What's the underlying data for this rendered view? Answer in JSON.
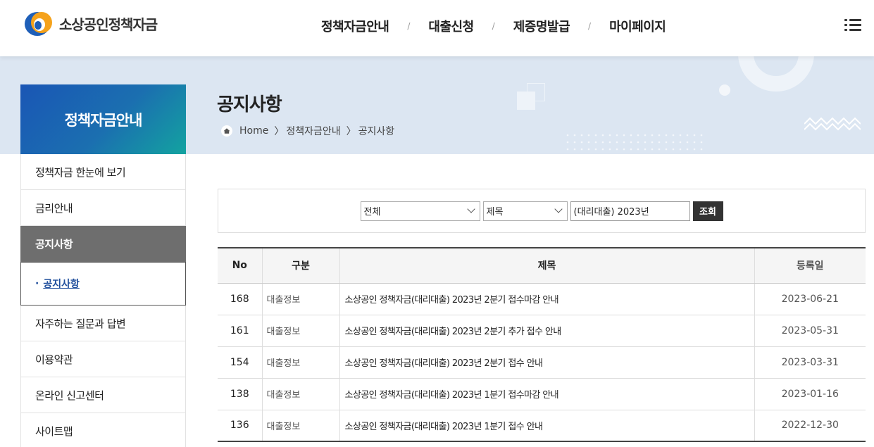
{
  "header": {
    "logo_text": "소상공인정책자금",
    "nav": [
      "정책자금안내",
      "대출신청",
      "제증명발급",
      "마이페이지"
    ],
    "nav_separator": "/"
  },
  "banner": {
    "side_title": "정책자금안내",
    "page_title": "공지사항",
    "breadcrumb": [
      "Home",
      "정책자금안내",
      "공지사항"
    ],
    "breadcrumb_separator": "〉"
  },
  "sidebar": {
    "items": [
      {
        "label": "정책자금 한눈에 보기"
      },
      {
        "label": "금리안내"
      },
      {
        "label": "공지사항"
      },
      {
        "label": "자주하는 질문과 답변"
      },
      {
        "label": "이용약관"
      },
      {
        "label": "온라인 신고센터"
      },
      {
        "label": "사이트맵"
      }
    ],
    "sub_item": {
      "bullet": "·",
      "label": "공지사항"
    }
  },
  "search": {
    "category_value": "전체",
    "field_value": "제목",
    "query_value": "(대리대출) 2023년",
    "button_label": "조회"
  },
  "table": {
    "headers": {
      "no": "No",
      "category": "구분",
      "title": "제목",
      "date": "등록일"
    },
    "rows": [
      {
        "no": "168",
        "category": "대출정보",
        "title": "소상공인 정책자금(대리대출) 2023년 2분기 접수마감 안내",
        "date": "2023-06-21"
      },
      {
        "no": "161",
        "category": "대출정보",
        "title": "소상공인 정책자금(대리대출) 2023년 2분기 추가 접수 안내",
        "date": "2023-05-31"
      },
      {
        "no": "154",
        "category": "대출정보",
        "title": "소상공인 정책자금(대리대출) 2023년 2분기 접수 안내",
        "date": "2023-03-31"
      },
      {
        "no": "138",
        "category": "대출정보",
        "title": "소상공인 정책자금(대리대출) 2023년 1분기 접수마감 안내",
        "date": "2023-01-16"
      },
      {
        "no": "136",
        "category": "대출정보",
        "title": "소상공인 정책자금(대리대출) 2023년 1분기 접수 안내",
        "date": "2022-12-30"
      }
    ]
  },
  "colors": {
    "brand_blue": "#1a56b5",
    "brand_orange": "#f5a21b",
    "banner_bg": "#dce6f2",
    "active_menu": "#6e6e6e"
  }
}
